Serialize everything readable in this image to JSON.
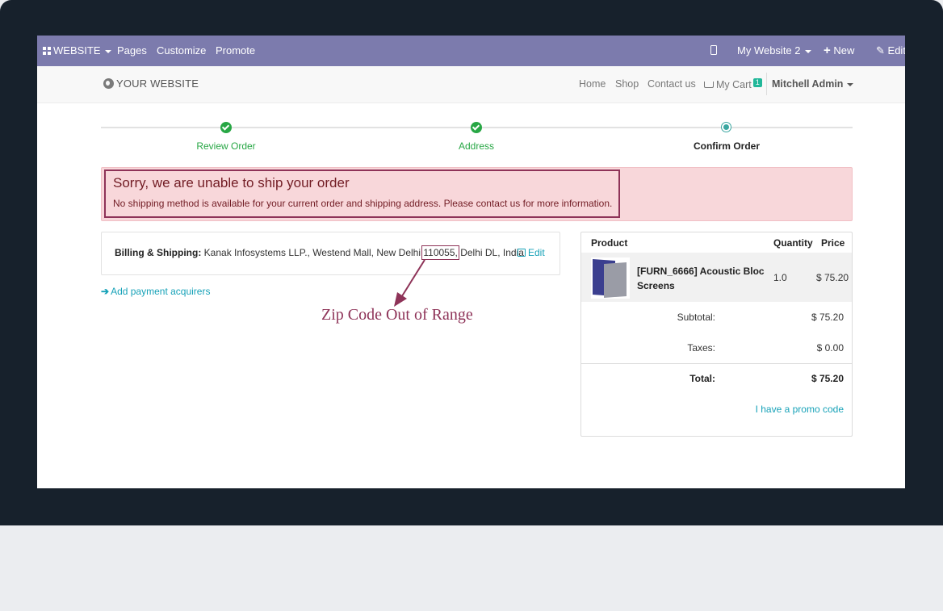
{
  "adminbar": {
    "website_label": "WEBSITE",
    "pages": "Pages",
    "customize": "Customize",
    "promote": "Promote",
    "site_switcher": "My Website 2",
    "new_label": "New",
    "edit_label": "Edit"
  },
  "header": {
    "logo": "YOUR WEBSITE",
    "nav": [
      "Home",
      "Shop",
      "Contact us"
    ],
    "cart_label": "My Cart",
    "cart_count": "1",
    "user": "Mitchell Admin"
  },
  "wizard": {
    "steps": [
      {
        "label": "Review Order",
        "state": "done"
      },
      {
        "label": "Address",
        "state": "done"
      },
      {
        "label": "Confirm Order",
        "state": "current"
      }
    ]
  },
  "alert": {
    "title": "Sorry, we are unable to ship your order",
    "message": "No shipping method is available for your current order and shipping address. Please contact us for more information."
  },
  "billing": {
    "label": "Billing & Shipping:",
    "address_before": "Kanak Infosystems LLP., Westend Mall, New Delhi ",
    "zip": "110055,",
    "address_after": " Delhi DL, India",
    "edit": "Edit"
  },
  "payment": {
    "add_acquirers": "Add payment acquirers"
  },
  "annotation": "Zip Code Out of Range",
  "summary": {
    "headers": {
      "product": "Product",
      "quantity": "Quantity",
      "price": "Price"
    },
    "line": {
      "name": "[FURN_6666] Acoustic Bloc Screens",
      "qty": "1.0",
      "price": "$ 75.20"
    },
    "subtotal_label": "Subtotal:",
    "subtotal": "$ 75.20",
    "taxes_label": "Taxes:",
    "taxes": "$ 0.00",
    "total_label": "Total:",
    "total": "$ 75.20",
    "promo": "I have a promo code"
  },
  "colors": {
    "adminbar": "#7c7bad",
    "success": "#28a745",
    "link": "#17a2b8",
    "alert_bg": "#f8d7da",
    "annotation": "#8e3358"
  }
}
